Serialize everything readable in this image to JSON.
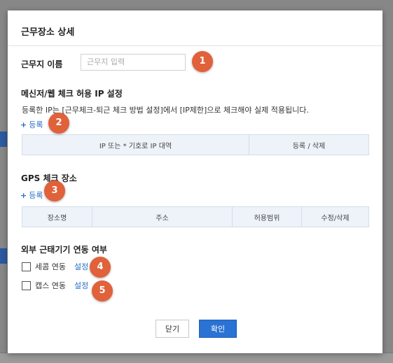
{
  "modal": {
    "title": "근무장소 상세",
    "name_label": "근무지 이름",
    "name_placeholder": "근무지 입력",
    "messenger_section": {
      "title": "메신저/웹 체크 허용 IP 설정",
      "description": "등록한 IP는 [근무체크-퇴근 체크 방법 설정]에서 [IP제한]으로 체크해야 실제 적용됩니다.",
      "register_link": "등록",
      "columns": [
        "IP 또는 * 기호로 IP 대역",
        "등록 / 삭제"
      ]
    },
    "gps_section": {
      "title": "GPS 체크 장소",
      "register_link": "등록",
      "columns": [
        "장소명",
        "주소",
        "허용범위",
        "수정/삭제"
      ]
    },
    "external_section": {
      "title": "외부 근태기기 연동 여부",
      "options": [
        {
          "label": "세콤 연동",
          "link": "설정",
          "checked": false
        },
        {
          "label": "캡스 연동",
          "link": "설정",
          "checked": false
        }
      ]
    },
    "buttons": {
      "close": "닫기",
      "confirm": "확인"
    }
  },
  "badges": [
    "1",
    "2",
    "3",
    "4",
    "5"
  ]
}
